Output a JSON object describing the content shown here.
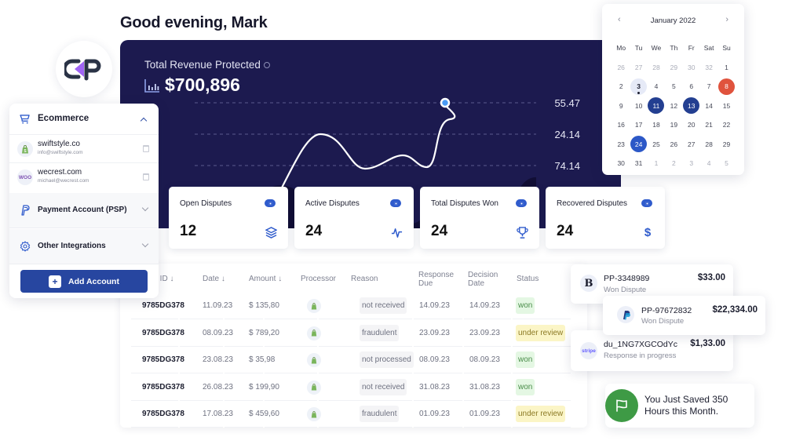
{
  "greeting": "Good evening, Mark",
  "brand": {
    "logo_text": "CP",
    "accent": "#a064f5",
    "dark": "#2a3346"
  },
  "hero": {
    "title": "Total Revenue Protected",
    "amount": "$700,896",
    "bg_color": "#1c1a4f"
  },
  "chart_data": {
    "type": "line",
    "title": "Total Revenue Protected",
    "y_tick_labels": [
      "55.47",
      "24.14",
      "74.14"
    ],
    "grid": true,
    "series": [
      {
        "name": "revenue-line",
        "color": "#ffffff",
        "values": [
          0,
          0.62,
          0.25,
          0.41,
          0.3,
          0.88,
          1.0
        ],
        "endpoint_marker": true
      },
      {
        "name": "background-area",
        "color": "#0f0d30",
        "values": [
          0.05,
          0.18,
          0.52,
          0.3,
          0.2,
          0.05,
          0.4,
          0.15,
          0.62
        ]
      }
    ]
  },
  "stats": [
    {
      "label": "Open Disputes",
      "value": "12",
      "icon": "layers-icon"
    },
    {
      "label": "Active Disputes",
      "value": "24",
      "icon": "activity-icon"
    },
    {
      "label": "Total Disputes Won",
      "value": "24",
      "icon": "trophy-icon"
    },
    {
      "label": "Recovered Disputes",
      "value": "24",
      "icon": "dollar-icon"
    }
  ],
  "table": {
    "headers": {
      "id": "Dispute ID ↓",
      "date": "Date ↓",
      "amount": "Amount ↓",
      "processor": "Processor",
      "reason": "Reason",
      "response_due": "Response Due",
      "decision_date": "Decision Date",
      "status": "Status"
    },
    "rows": [
      {
        "id": "9785DG378",
        "date": "11.09.23",
        "amount": "$ 135,80",
        "processor": "shopify",
        "reason": "not received",
        "response_due": "14.09.23",
        "decision_date": "14.09.23",
        "status": "won"
      },
      {
        "id": "9785DG378",
        "date": "08.09.23",
        "amount": "$ 789,20",
        "processor": "shopify",
        "reason": "fraudulent",
        "response_due": "23.09.23",
        "decision_date": "23.09.23",
        "status": "under review"
      },
      {
        "id": "9785DG378",
        "date": "23.08.23",
        "amount": "$ 35,98",
        "processor": "shopify",
        "reason": "not processed",
        "response_due": "08.09.23",
        "decision_date": "08.09.23",
        "status": "won"
      },
      {
        "id": "9785DG378",
        "date": "26.08.23",
        "amount": "$ 199,90",
        "processor": "shopify",
        "reason": "not received",
        "response_due": "31.08.23",
        "decision_date": "31.08.23",
        "status": "won"
      },
      {
        "id": "9785DG378",
        "date": "17.08.23",
        "amount": "$ 459,60",
        "processor": "shopify",
        "reason": "fraudulent",
        "response_due": "01.09.23",
        "decision_date": "01.09.23",
        "status": "under review"
      }
    ]
  },
  "integrations": {
    "ecommerce_label": "Ecommerce",
    "accounts": [
      {
        "name": "swiftstyle.co",
        "email": "info@swiftstyle.com",
        "platform": "shopify"
      },
      {
        "name": "wecrest.com",
        "email": "michael@wecrest.com",
        "platform": "woo",
        "badge": "WOO"
      }
    ],
    "psp_label": "Payment Account (PSP)",
    "other_label": "Other Integrations",
    "add_button": "Add Account",
    "add_icon": "+"
  },
  "calendar": {
    "title": "January 2022",
    "prev": "‹",
    "next": "›",
    "weekdays": [
      "Mo",
      "Tu",
      "We",
      "Th",
      "Fr",
      "Sat",
      "Su"
    ],
    "weeks": [
      [
        [
          "26",
          "muted"
        ],
        [
          "27",
          "muted"
        ],
        [
          "28",
          "muted"
        ],
        [
          "29",
          "muted"
        ],
        [
          "30",
          "muted"
        ],
        [
          "32",
          "muted"
        ],
        [
          "1",
          ""
        ]
      ],
      [
        [
          "2",
          ""
        ],
        [
          "3",
          "today"
        ],
        [
          "4",
          ""
        ],
        [
          "5",
          ""
        ],
        [
          "6",
          ""
        ],
        [
          "7",
          ""
        ],
        [
          "8",
          "red"
        ]
      ],
      [
        [
          "9",
          ""
        ],
        [
          "10",
          ""
        ],
        [
          "11",
          "navy"
        ],
        [
          "12",
          ""
        ],
        [
          "13",
          "navy"
        ],
        [
          "14",
          ""
        ],
        [
          "15",
          ""
        ]
      ],
      [
        [
          "16",
          ""
        ],
        [
          "17",
          ""
        ],
        [
          "18",
          ""
        ],
        [
          "19",
          ""
        ],
        [
          "20",
          ""
        ],
        [
          "21",
          ""
        ],
        [
          "22",
          ""
        ]
      ],
      [
        [
          "23",
          ""
        ],
        [
          "24",
          "blue"
        ],
        [
          "25",
          ""
        ],
        [
          "26",
          ""
        ],
        [
          "27",
          ""
        ],
        [
          "28",
          ""
        ],
        [
          "29",
          ""
        ]
      ],
      [
        [
          "30",
          ""
        ],
        [
          "31",
          ""
        ],
        [
          "1",
          "muted"
        ],
        [
          "2",
          "muted"
        ],
        [
          "3",
          "muted"
        ],
        [
          "4",
          "muted"
        ],
        [
          "5",
          "muted"
        ]
      ]
    ]
  },
  "transactions": [
    {
      "id": "PP-3348989",
      "status": "Won Dispute",
      "amount": "$33.00",
      "provider": "B"
    },
    {
      "id": "PP-97672832",
      "status": "Won Dispute",
      "amount": "$22,334.00",
      "provider": "P"
    },
    {
      "id": "du_1NG7XGCOdYc",
      "status": "Response in progress",
      "amount": "$1,33.00",
      "provider": "stripe"
    }
  ],
  "toast": {
    "text": "You Just Saved 350 Hours this Month."
  }
}
